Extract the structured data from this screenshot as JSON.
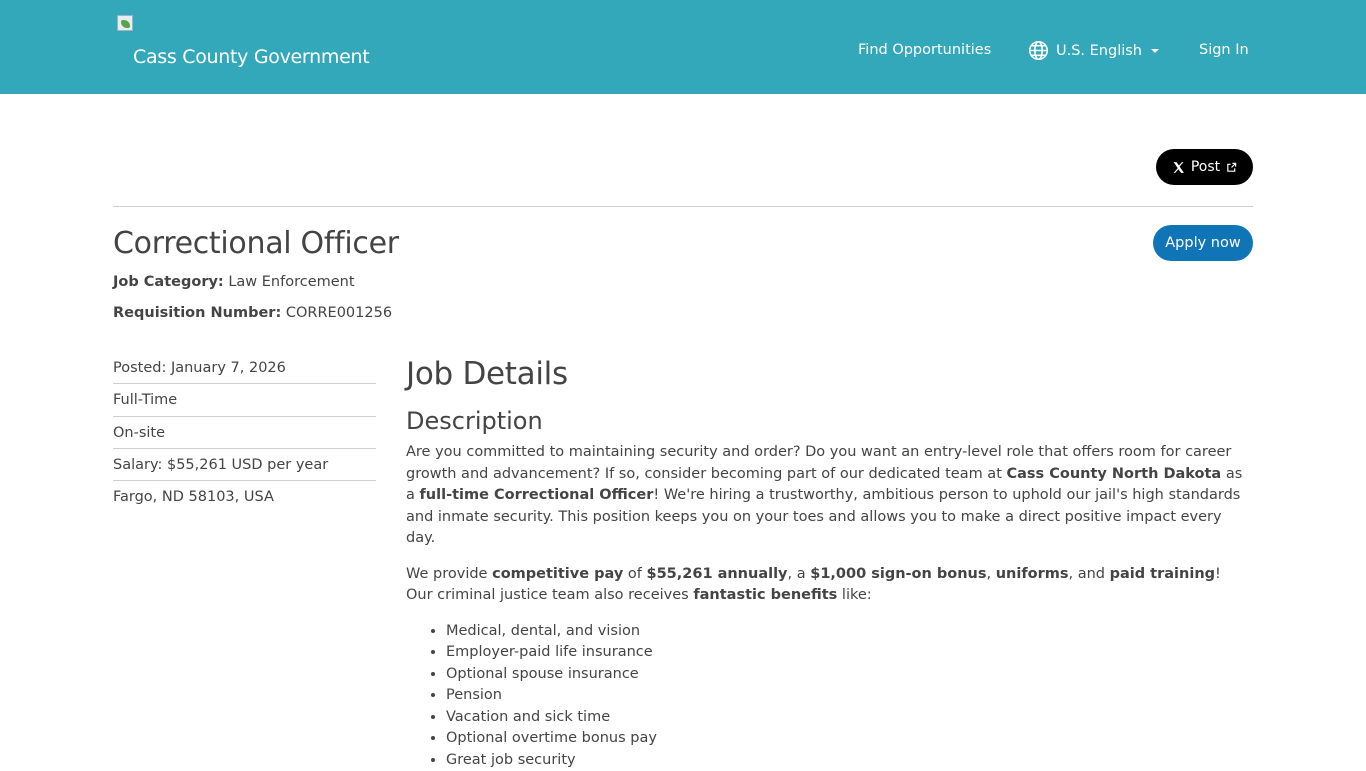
{
  "header": {
    "brand": "Cass County Government",
    "nav": {
      "find": "Find Opportunities",
      "language": "U.S. English",
      "signin": "Sign In"
    }
  },
  "share": {
    "post_label": "Post"
  },
  "job": {
    "title": "Correctional Officer",
    "apply_label": "Apply now",
    "category_label": "Job Category:",
    "category_value": "Law Enforcement",
    "req_label": "Requisition Number:",
    "req_value": "CORRE001256"
  },
  "sidebar": {
    "items": [
      "Posted: January 7, 2026",
      "Full-Time",
      "On-site",
      "Salary: $55,261 USD per year",
      "Fargo, ND 58103, USA"
    ]
  },
  "details": {
    "heading": "Job Details",
    "subheading": "Description",
    "p1": {
      "t1": "Are you committed to maintaining security and order? Do you want an entry-level role that offers room for career growth and advancement? If so, consider becoming part of our dedicated team at ",
      "b1": "Cass County North Dakota",
      "t2": " as a ",
      "b2": "full-time Correctional Officer",
      "t3": "! We're hiring a trustworthy, ambitious person to uphold our jail's high standards and inmate security. This position keeps you on your toes and allows you to make a direct positive impact every day."
    },
    "p2": {
      "t1": "We provide ",
      "b1": "competitive pay",
      "t2": " of ",
      "b2": "$55,261 annually",
      "t3": ", a ",
      "b3": "$1,000 sign-on bonus",
      "t4": ", ",
      "b4": "uniforms",
      "t5": ", and ",
      "b5": "paid training",
      "t6": "! Our criminal justice team also receives ",
      "b6": "fantastic benefits",
      "t7": " like:"
    },
    "benefits": [
      "Medical, dental, and vision",
      "Employer-paid life insurance",
      "Optional spouse insurance",
      "Pension",
      "Vacation and sick time",
      "Optional overtime bonus pay",
      "Great job security"
    ]
  }
}
